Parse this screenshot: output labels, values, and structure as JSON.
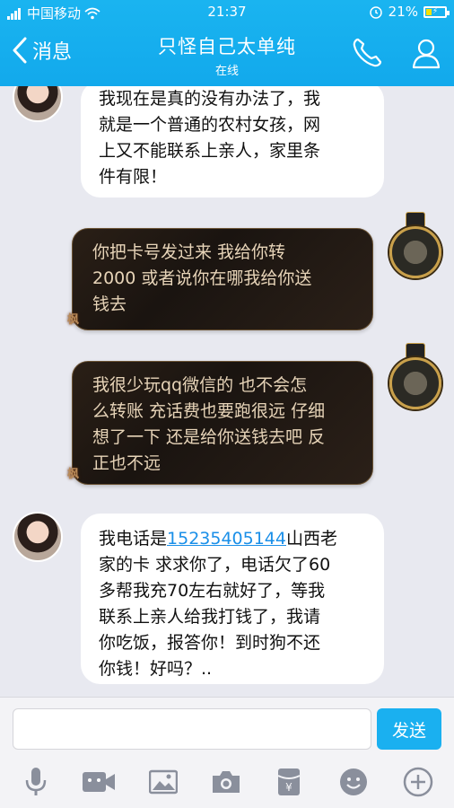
{
  "status_bar": {
    "carrier": "中国移动",
    "time": "21:37",
    "battery": "21%"
  },
  "header": {
    "back_label": "消息",
    "title": "只怪自己太单纯",
    "subtitle": "在线",
    "phone_icon": "phone-icon",
    "profile_icon": "profile-icon"
  },
  "messages": [
    {
      "side": "left",
      "lines": [
        "我现在是真的没有办法了，我",
        "就是一个普通的农村女孩，网",
        "上又不能联系上亲人，家里条",
        "件有限！"
      ]
    },
    {
      "side": "right",
      "lines": [
        "你把卡号发过来  我给你转",
        "2000  或者说你在哪我给你送",
        "钱去"
      ]
    },
    {
      "side": "right",
      "lines": [
        "我很少玩qq微信的 也不会怎",
        "么转账 充话费也要跑很远 仔细",
        "想了一下 还是给你送钱去吧 反",
        "正也不远"
      ]
    },
    {
      "side": "left",
      "prefix": "我电话是",
      "phone": "15235405144",
      "after_phone": "山西老",
      "lines": [
        "家的卡 求求你了，电话欠了60",
        "多帮我充70左右就好了，等我",
        "联系上亲人给我打钱了，我请",
        "你吃饭，报答你！到时狗不还",
        "你钱！好吗？.."
      ]
    }
  ],
  "bubble_deco": "枫",
  "input": {
    "placeholder": "",
    "send_label": "发送"
  },
  "toolbar_icons": [
    "microphone-icon",
    "video-icon",
    "image-icon",
    "camera-icon",
    "red-packet-icon",
    "emoji-icon",
    "plus-icon"
  ],
  "colors": {
    "header": "#12a9ec",
    "send": "#1ab0f0",
    "link": "#1a8fe8"
  }
}
